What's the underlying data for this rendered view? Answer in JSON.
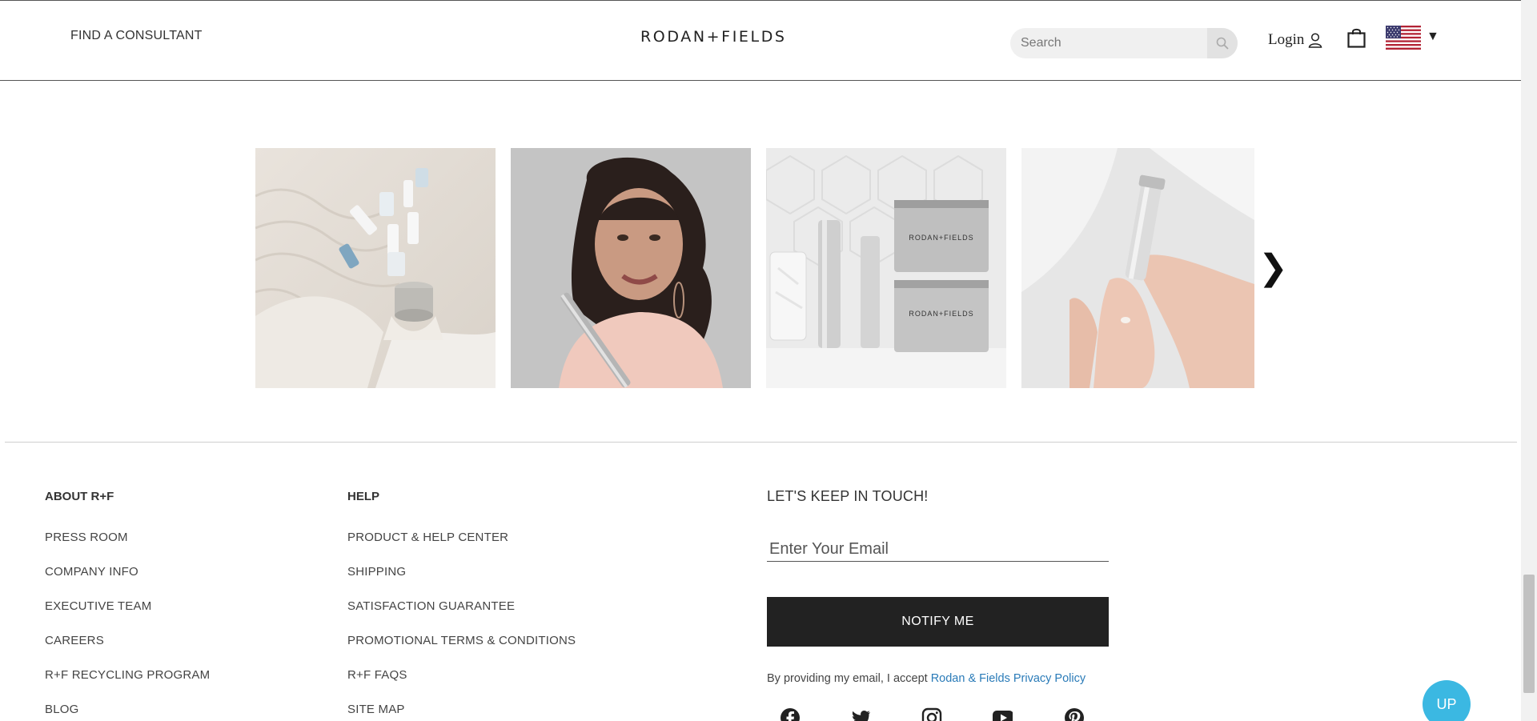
{
  "header": {
    "find_consultant": "FIND A CONSULTANT",
    "logo": "RODAN+FIELDS",
    "search_placeholder": "Search",
    "login_label": "Login",
    "cart_icon": "shopping-bag-icon",
    "flag_icon": "us-flag-icon"
  },
  "gallery": {
    "next_arrow": "❯",
    "tiles": [
      "instagram-photo-1",
      "instagram-photo-2",
      "instagram-photo-3",
      "instagram-photo-4"
    ]
  },
  "footer": {
    "about": {
      "title": "ABOUT R+F",
      "links": [
        "PRESS ROOM",
        "COMPANY INFO",
        "EXECUTIVE TEAM",
        "CAREERS",
        "R+F RECYCLING PROGRAM",
        "BLOG"
      ]
    },
    "help": {
      "title": "HELP",
      "links": [
        "PRODUCT & HELP CENTER",
        "SHIPPING",
        "SATISFACTION GUARANTEE",
        "PROMOTIONAL TERMS & CONDITIONS",
        "R+F FAQS",
        "SITE MAP"
      ]
    },
    "newsletter": {
      "title": "LET'S KEEP IN TOUCH!",
      "email_placeholder": "Enter Your Email",
      "button": "NOTIFY ME",
      "consent_text": "By providing my email, I accept ",
      "privacy_link": "Rodan & Fields Privacy Policy"
    },
    "social": [
      "facebook-icon",
      "twitter-icon",
      "instagram-icon",
      "youtube-icon",
      "pinterest-icon"
    ]
  },
  "up_button": "UP",
  "colors": {
    "button_dark": "#222222",
    "link_blue": "#2a7bb8",
    "up_button": "#3bb8e2"
  }
}
